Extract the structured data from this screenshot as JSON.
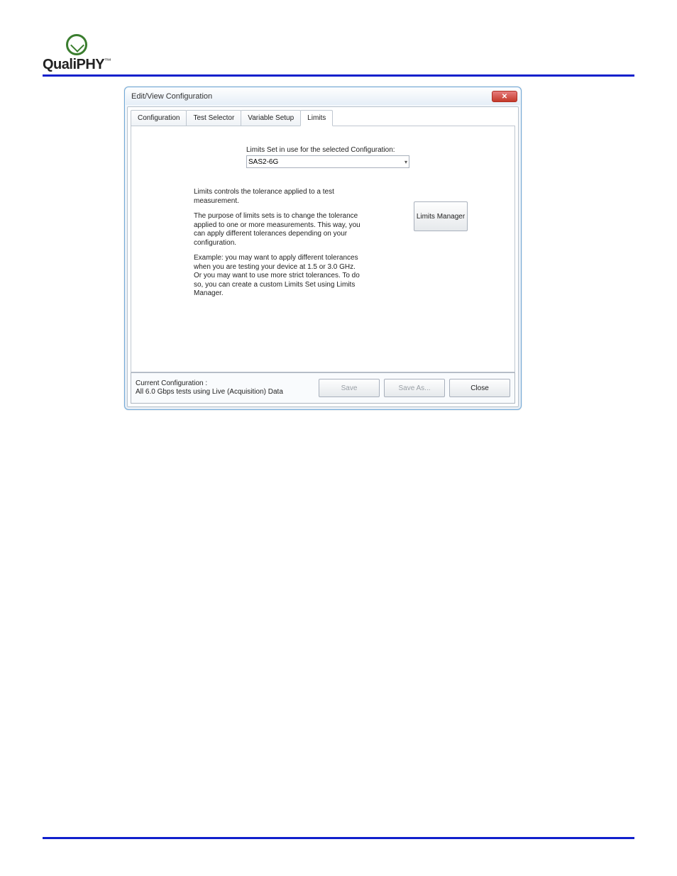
{
  "brand": {
    "name": "QualiPHY"
  },
  "dialog": {
    "title": "Edit/View Configuration",
    "tabs": [
      {
        "label": "Configuration"
      },
      {
        "label": "Test Selector"
      },
      {
        "label": "Variable Setup"
      },
      {
        "label": "Limits"
      }
    ],
    "limits": {
      "select_label": "Limits Set in use for the selected Configuration:",
      "dropdown_value": "SAS2-6G",
      "paragraphs": [
        "Limits controls the tolerance applied to a test measurement.",
        "The purpose of limits sets is to change the tolerance applied to one or more measurements. This way, you can apply different tolerances depending on your configuration.",
        "Example: you may want to apply different tolerances when you are testing your device at 1.5 or 3.0 GHz. Or you may want to use more strict tolerances. To do so, you can create a custom Limits Set using Limits Manager."
      ],
      "limits_manager_button": "Limits Manager"
    },
    "footer": {
      "current_label": "Current Configuration :",
      "current_value": "All 6.0 Gbps tests using Live (Acquisition) Data",
      "save": "Save",
      "save_as": "Save As...",
      "close": "Close"
    }
  }
}
